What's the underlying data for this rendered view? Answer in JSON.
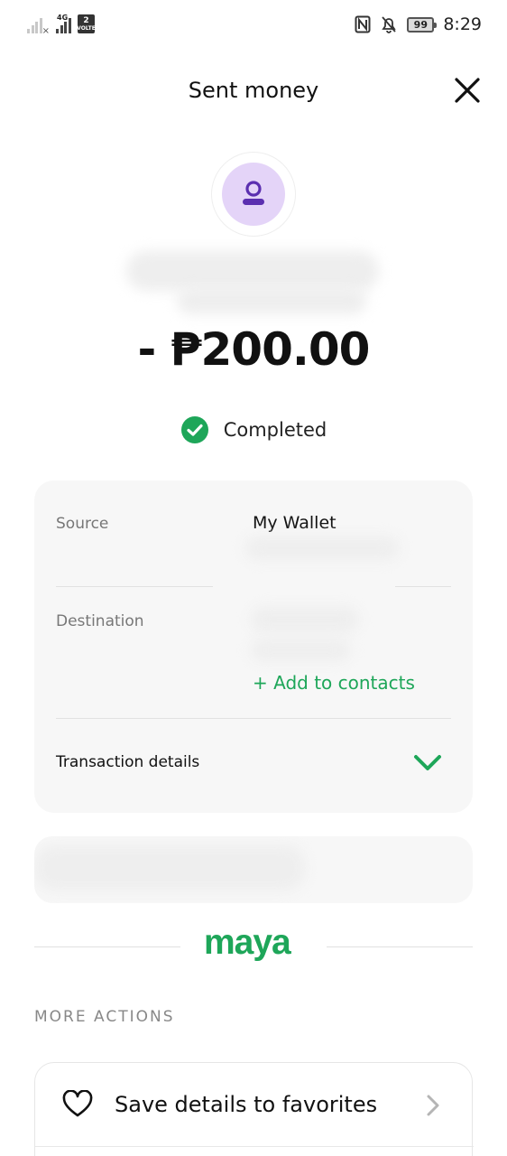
{
  "status_bar": {
    "network_tag": "4G",
    "sim_badge_number": "2",
    "sim_badge_text": "VOLTE",
    "battery": "99",
    "time": "8:29"
  },
  "header": {
    "title": "Sent money"
  },
  "transaction": {
    "amount": "- ₱200.00",
    "status": "Completed"
  },
  "details_card": {
    "source_label": "Source",
    "source_value": "My Wallet",
    "destination_label": "Destination",
    "add_contacts_label": "+ Add to contacts",
    "transaction_details_label": "Transaction details"
  },
  "brand": {
    "logo_text": "maya"
  },
  "more_actions": {
    "section_title": "MORE ACTIONS",
    "items": [
      {
        "label": "Save details to favorites",
        "icon": "heart-icon"
      }
    ]
  },
  "colors": {
    "accent_green": "#1ea659",
    "avatar_bg": "#e4d4f8",
    "avatar_icon": "#5b2fb0",
    "card_bg": "#f7f7f7"
  }
}
